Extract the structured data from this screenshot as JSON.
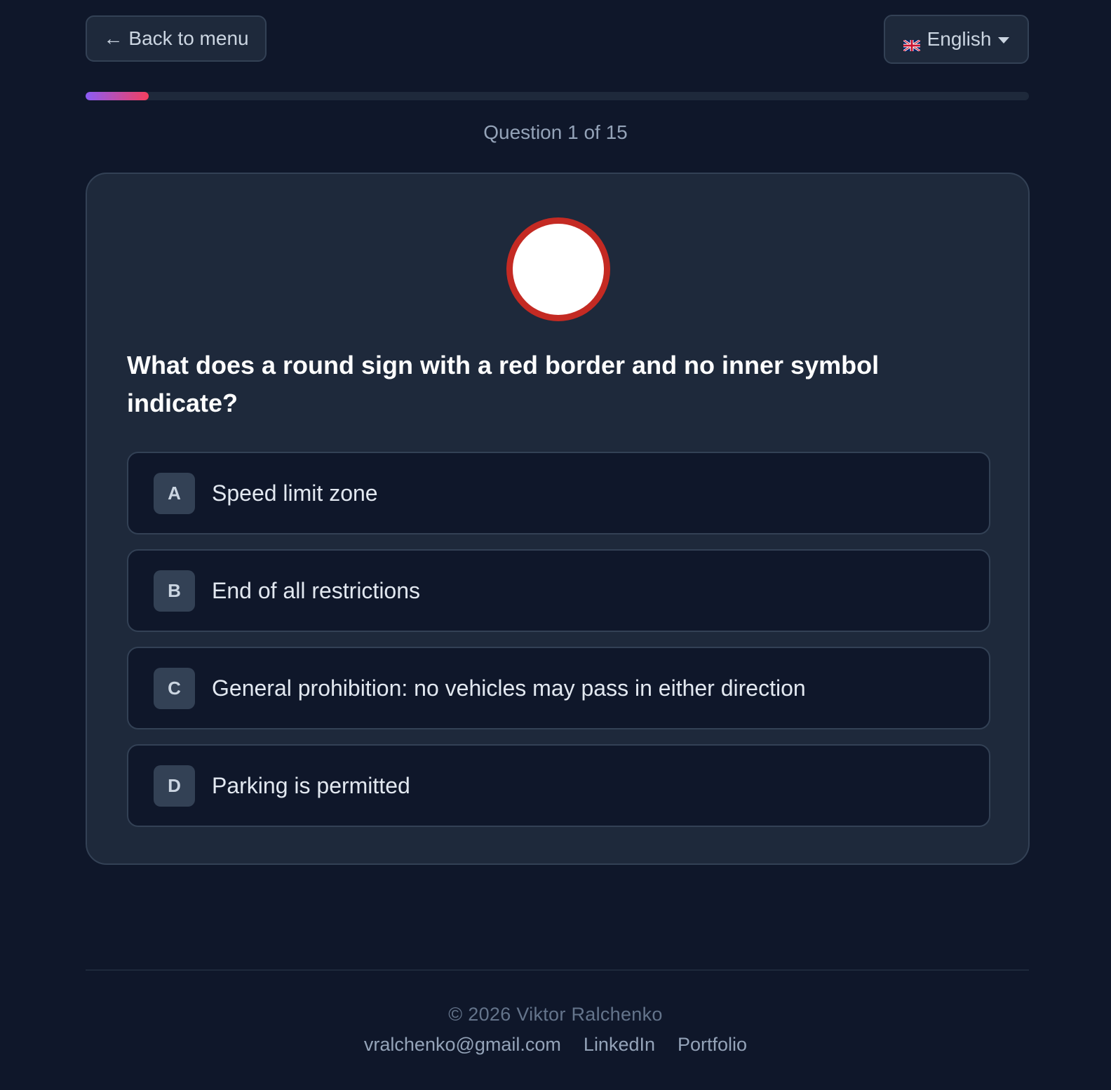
{
  "header": {
    "back_label": "Back to menu",
    "back_arrow": "←",
    "language_label": "English",
    "language_flag_icon": "uk-flag-icon"
  },
  "progress": {
    "current": 1,
    "total": 15,
    "label": "Question 1 of 15",
    "fraction": 0.067
  },
  "question": {
    "sign": {
      "shape": "circle",
      "border_color": "#c42a23",
      "fill_color": "#ffffff"
    },
    "text": "What does a round sign with a red border and no inner symbol indicate?",
    "options": [
      {
        "letter": "A",
        "text": "Speed limit zone"
      },
      {
        "letter": "B",
        "text": "End of all restrictions"
      },
      {
        "letter": "C",
        "text": "General prohibition: no vehicles may pass in either direction"
      },
      {
        "letter": "D",
        "text": "Parking is permitted"
      }
    ]
  },
  "footer": {
    "copyright": "© 2026 Viktor Ralchenko",
    "links": {
      "email": "vralchenko@gmail.com",
      "linkedin": "LinkedIn",
      "portfolio": "Portfolio"
    }
  },
  "colors": {
    "background": "#0f172a",
    "card": "#1e293b",
    "border": "#334155",
    "progress_start": "#8b5cf6",
    "progress_end": "#f43f5e"
  }
}
